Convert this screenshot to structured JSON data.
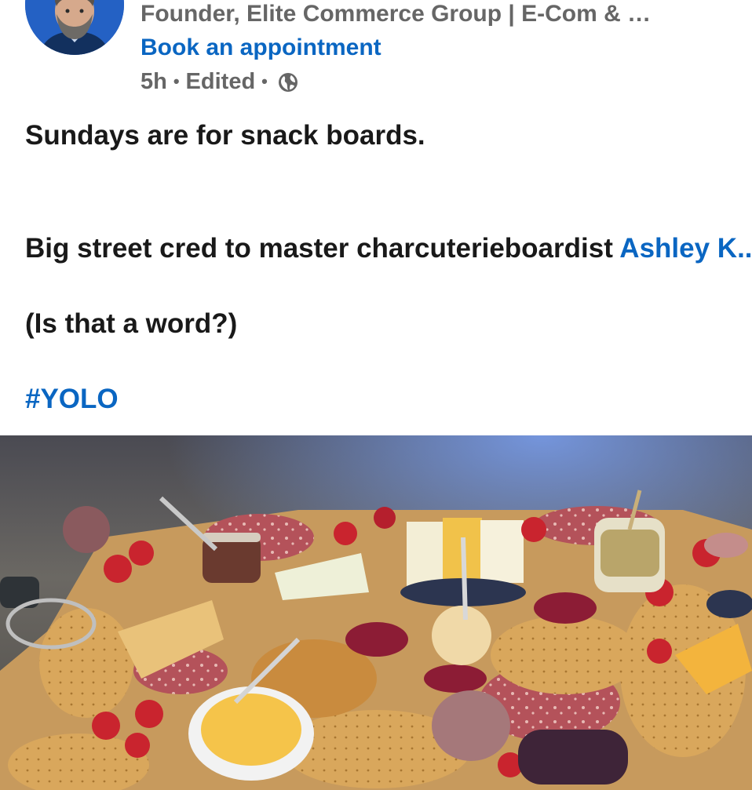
{
  "post": {
    "author_headline": "Founder, Elite Commerce Group | E-Com & …",
    "book_link": "Book an appointment",
    "time": "5h",
    "separator": "•",
    "edited": "Edited",
    "visibility_icon": "globe-icon"
  },
  "body": {
    "line1": "Sundays are for snack boards.",
    "line2_prefix": "Big street cred to master charcuterieboardist ",
    "line2_mention": "Ashley K..",
    "line3": "(Is that a word?)",
    "hashtag": "#YOLO"
  },
  "media": {
    "type": "photo"
  },
  "colors": {
    "link": "#0a66c2",
    "meta_text": "#666666",
    "body_text": "#191919"
  }
}
